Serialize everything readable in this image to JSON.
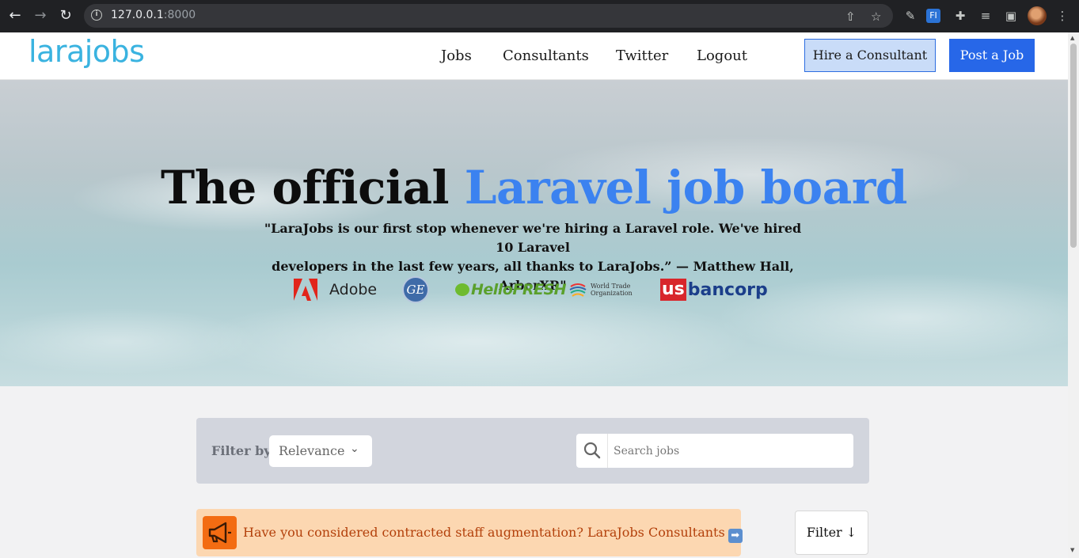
{
  "browser": {
    "url_host": "127.0.0.1",
    "url_port": ":8000",
    "back_icon": "arrow-left",
    "forward_icon": "arrow-right",
    "reload_icon": "reload",
    "extension_label": "FI"
  },
  "header": {
    "logo": "larajobs",
    "nav": [
      "Jobs",
      "Consultants",
      "Twitter",
      "Logout"
    ],
    "hire_label": "Hire a Consultant",
    "post_label": "Post a Job"
  },
  "hero": {
    "title_plain": "The official ",
    "title_accent": "Laravel job board",
    "quote_line1": "\"LaraJobs is our first stop whenever we're hiring a Laravel role. We've hired 10 Laravel",
    "quote_line2": "developers in the last few years, all thanks to LaraJobs.” — Matthew Hall, ArborXR\"",
    "brands": {
      "adobe": "Adobe",
      "ge": "GE",
      "hellofresh": "HelloFRESH",
      "wto_line1": "World Trade",
      "wto_line2": "Organization",
      "us": "us",
      "bancorp": "bancorp"
    }
  },
  "filter": {
    "label": "Filter by",
    "selected": "Relevance",
    "search_placeholder": "Search jobs"
  },
  "promo": {
    "text": "Have you considered contracted staff augmentation? LaraJobs Consultants",
    "arrow": "➡"
  },
  "filter_button": "Filter ↓",
  "colors": {
    "accent": "#3b82f0",
    "logo": "#3ab3e0",
    "primary_button": "#2767e8",
    "promo_bg": "#fcd7b1",
    "promo_icon": "#f36c12"
  }
}
